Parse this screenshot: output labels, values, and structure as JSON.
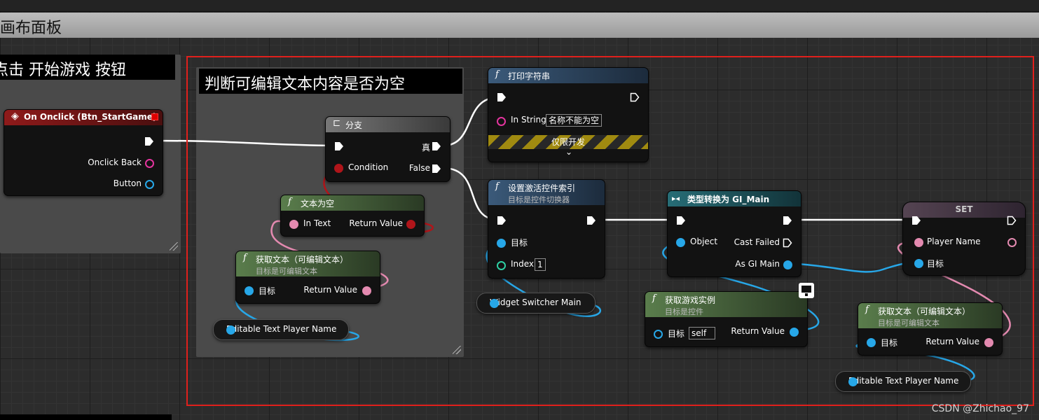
{
  "window": {
    "title": "画布面板"
  },
  "comments": {
    "event_group": "点击 开始游戏 按钮",
    "branch_group": "判断可编辑文本内容是否为空"
  },
  "nodes": {
    "on_click": {
      "title": "On Onclick (Btn_StartGame)",
      "pins": [
        "Onclick Back",
        "Button"
      ]
    },
    "branch": {
      "title": "分支",
      "condition": "Condition",
      "true": "真",
      "false": "False"
    },
    "print_string": {
      "title": "打印字符串",
      "in_string_label": "In String",
      "in_string_value": "名称不能为空",
      "dev_only": "仅限开发"
    },
    "is_empty": {
      "title": "文本为空",
      "in": "In Text",
      "out": "Return Value"
    },
    "get_text_1": {
      "title": "获取文本（可编辑文本）",
      "subtitle": "目标是可编辑文本",
      "target": "目标",
      "out": "Return Value"
    },
    "editable_var_1": {
      "label": "Editable Text Player Name"
    },
    "set_active": {
      "title": "设置激活控件索引",
      "subtitle": "目标是控件切换器",
      "target": "目标",
      "index_label": "Index",
      "index_value": "1"
    },
    "widget_switcher": {
      "label": "Widget Switcher Main"
    },
    "cast": {
      "title": "类型转换为 GI_Main",
      "object": "Object",
      "cast_failed": "Cast Failed",
      "as_main": "As GI Main"
    },
    "get_instance": {
      "title": "获取游戏实例",
      "subtitle": "目标是控件",
      "target": "目标",
      "self": "self",
      "out": "Return Value"
    },
    "set": {
      "title": "SET",
      "player_name": "Player Name",
      "target": "目标"
    },
    "get_text_2": {
      "title": "获取文本（可编辑文本）",
      "subtitle": "目标是可编辑文本",
      "target": "目标",
      "out": "Return Value"
    },
    "editable_var_2": {
      "label": "Editable Text Player Name"
    }
  },
  "watermark": "CSDN @Zhichao_97",
  "colors": {
    "exec": "#ffffff",
    "object": "#27a7e8",
    "bool": "#b0151a",
    "text": "#e48ab0",
    "string": "#e4349e",
    "int": "#2ed1a4",
    "selection": "#e0201c"
  }
}
